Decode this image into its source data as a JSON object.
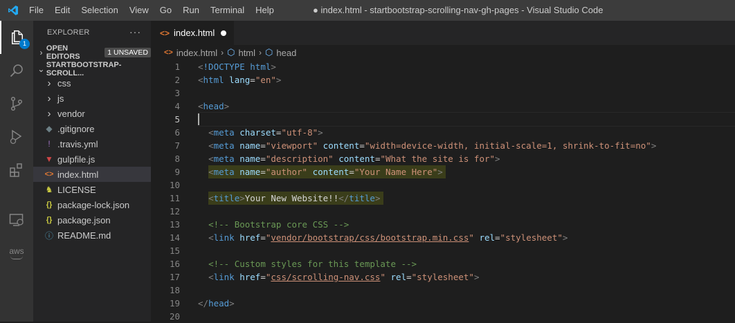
{
  "titlebar": {
    "menu": [
      "File",
      "Edit",
      "Selection",
      "View",
      "Go",
      "Run",
      "Terminal",
      "Help"
    ],
    "title": "● index.html - startbootstrap-scrolling-nav-gh-pages - Visual Studio Code"
  },
  "activity_bar": {
    "items": [
      "explorer-icon",
      "search-icon",
      "source-control-icon",
      "run-debug-icon",
      "extensions-icon",
      "remote-explorer-icon",
      "aws-icon"
    ],
    "explorer_badge": "1",
    "aws_label": "aws"
  },
  "sidebar": {
    "header": "EXPLORER",
    "more": "···",
    "open_editors": {
      "label": "OPEN EDITORS",
      "badge": "1 UNSAVED"
    },
    "project": {
      "label": "STARTBOOTSTRAP-SCROLL..."
    },
    "tree": [
      {
        "name": "css",
        "icon": "›",
        "type": "folder"
      },
      {
        "name": "js",
        "icon": "›",
        "type": "folder"
      },
      {
        "name": "vendor",
        "icon": "›",
        "type": "folder"
      },
      {
        "name": ".gitignore",
        "icon": "◆",
        "type": "file",
        "color": "#6d8086"
      },
      {
        "name": ".travis.yml",
        "icon": "!",
        "type": "file",
        "color": "#a074c4"
      },
      {
        "name": "gulpfile.js",
        "icon": "▼",
        "type": "file",
        "color": "#cf4647"
      },
      {
        "name": "index.html",
        "icon": "<>",
        "type": "file",
        "color": "#e37933",
        "selected": true
      },
      {
        "name": "LICENSE",
        "icon": "♞",
        "type": "file",
        "color": "#cbcb41"
      },
      {
        "name": "package-lock.json",
        "icon": "{}",
        "type": "file",
        "color": "#cbcb41"
      },
      {
        "name": "package.json",
        "icon": "{}",
        "type": "file",
        "color": "#cbcb41"
      },
      {
        "name": "README.md",
        "icon": "ⓘ",
        "type": "file",
        "color": "#519aba"
      }
    ]
  },
  "editor": {
    "tab": {
      "label": "index.html",
      "icon": "<>"
    },
    "breadcrumb": [
      "index.html",
      "html",
      "head"
    ],
    "lines": [
      {
        "n": "1",
        "tokens": [
          [
            "t-tag",
            "<"
          ],
          [
            "t-dt",
            "!DOCTYPE"
          ],
          [
            "t-text",
            " "
          ],
          [
            "t-name",
            "html"
          ],
          [
            "t-tag",
            ">"
          ]
        ]
      },
      {
        "n": "2",
        "tokens": [
          [
            "t-tag",
            "<"
          ],
          [
            "t-name",
            "html"
          ],
          [
            "t-text",
            " "
          ],
          [
            "t-attr",
            "lang"
          ],
          [
            "t-text",
            "="
          ],
          [
            "t-str",
            "\"en\""
          ],
          [
            "t-tag",
            ">"
          ]
        ]
      },
      {
        "n": "3",
        "tokens": []
      },
      {
        "n": "4",
        "tokens": [
          [
            "t-tag",
            "<"
          ],
          [
            "t-name",
            "head"
          ],
          [
            "t-tag",
            ">"
          ]
        ]
      },
      {
        "n": "5",
        "tokens": [],
        "current": true
      },
      {
        "n": "6",
        "tokens": [
          [
            "t-text",
            "  "
          ],
          [
            "t-tag",
            "<"
          ],
          [
            "t-name",
            "meta"
          ],
          [
            "t-text",
            " "
          ],
          [
            "t-attr",
            "charset"
          ],
          [
            "t-text",
            "="
          ],
          [
            "t-str",
            "\"utf-8\""
          ],
          [
            "t-tag",
            ">"
          ]
        ]
      },
      {
        "n": "7",
        "tokens": [
          [
            "t-text",
            "  "
          ],
          [
            "t-tag",
            "<"
          ],
          [
            "t-name",
            "meta"
          ],
          [
            "t-text",
            " "
          ],
          [
            "t-attr",
            "name"
          ],
          [
            "t-text",
            "="
          ],
          [
            "t-str",
            "\"viewport\""
          ],
          [
            "t-text",
            " "
          ],
          [
            "t-attr",
            "content"
          ],
          [
            "t-text",
            "="
          ],
          [
            "t-str",
            "\"width=device-width, initial-scale=1, shrink-to-fit=no\""
          ],
          [
            "t-tag",
            ">"
          ]
        ]
      },
      {
        "n": "8",
        "tokens": [
          [
            "t-text",
            "  "
          ],
          [
            "t-tag",
            "<"
          ],
          [
            "t-name",
            "meta"
          ],
          [
            "t-text",
            " "
          ],
          [
            "t-attr",
            "name"
          ],
          [
            "t-text",
            "="
          ],
          [
            "t-str",
            "\"description\""
          ],
          [
            "t-text",
            " "
          ],
          [
            "t-attr",
            "content"
          ],
          [
            "t-text",
            "="
          ],
          [
            "t-str",
            "\"What the site is for\""
          ],
          [
            "t-tag",
            ">"
          ]
        ]
      },
      {
        "n": "9",
        "tokens": [
          [
            "t-text",
            "  "
          ],
          [
            "t-tag",
            "<"
          ],
          [
            "t-name",
            "meta"
          ],
          [
            "t-text",
            " "
          ],
          [
            "t-attr",
            "name"
          ],
          [
            "t-text",
            "="
          ],
          [
            "t-str",
            "\"author\""
          ],
          [
            "t-text",
            " "
          ],
          [
            "t-attr",
            "content"
          ],
          [
            "t-text",
            "="
          ],
          [
            "t-str",
            "\"Your Name Here\""
          ],
          [
            "t-tag",
            ">"
          ]
        ],
        "highlight": true
      },
      {
        "n": "10",
        "tokens": []
      },
      {
        "n": "11",
        "tokens": [
          [
            "t-text",
            "  "
          ],
          [
            "t-tag",
            "<"
          ],
          [
            "t-name",
            "title"
          ],
          [
            "t-tag",
            ">"
          ],
          [
            "t-text",
            "Your New Website!!"
          ],
          [
            "t-tag",
            "</"
          ],
          [
            "t-name",
            "title"
          ],
          [
            "t-tag",
            ">"
          ]
        ],
        "highlight": true
      },
      {
        "n": "12",
        "tokens": []
      },
      {
        "n": "13",
        "tokens": [
          [
            "t-text",
            "  "
          ],
          [
            "t-com",
            "<!-- Bootstrap core CSS -->"
          ]
        ]
      },
      {
        "n": "14",
        "tokens": [
          [
            "t-text",
            "  "
          ],
          [
            "t-tag",
            "<"
          ],
          [
            "t-name",
            "link"
          ],
          [
            "t-text",
            " "
          ],
          [
            "t-attr",
            "href"
          ],
          [
            "t-text",
            "="
          ],
          [
            "t-str",
            "\""
          ],
          [
            "t-link",
            "vendor/bootstrap/css/bootstrap.min.css"
          ],
          [
            "t-str",
            "\""
          ],
          [
            "t-text",
            " "
          ],
          [
            "t-attr",
            "rel"
          ],
          [
            "t-text",
            "="
          ],
          [
            "t-str",
            "\"stylesheet\""
          ],
          [
            "t-tag",
            ">"
          ]
        ]
      },
      {
        "n": "15",
        "tokens": []
      },
      {
        "n": "16",
        "tokens": [
          [
            "t-text",
            "  "
          ],
          [
            "t-com",
            "<!-- Custom styles for this template -->"
          ]
        ]
      },
      {
        "n": "17",
        "tokens": [
          [
            "t-text",
            "  "
          ],
          [
            "t-tag",
            "<"
          ],
          [
            "t-name",
            "link"
          ],
          [
            "t-text",
            " "
          ],
          [
            "t-attr",
            "href"
          ],
          [
            "t-text",
            "="
          ],
          [
            "t-str",
            "\""
          ],
          [
            "t-link",
            "css/scrolling-nav.css"
          ],
          [
            "t-str",
            "\""
          ],
          [
            "t-text",
            " "
          ],
          [
            "t-attr",
            "rel"
          ],
          [
            "t-text",
            "="
          ],
          [
            "t-str",
            "\"stylesheet\""
          ],
          [
            "t-tag",
            ">"
          ]
        ]
      },
      {
        "n": "18",
        "tokens": []
      },
      {
        "n": "19",
        "tokens": [
          [
            "t-tag",
            "</"
          ],
          [
            "t-name",
            "head"
          ],
          [
            "t-tag",
            ">"
          ]
        ]
      },
      {
        "n": "20",
        "tokens": []
      }
    ]
  },
  "colors": {
    "accent": "#007acc",
    "titlebar": "#3c3c3c",
    "activitybar": "#333333",
    "sidebar": "#252526",
    "editor": "#1e1e1e"
  }
}
